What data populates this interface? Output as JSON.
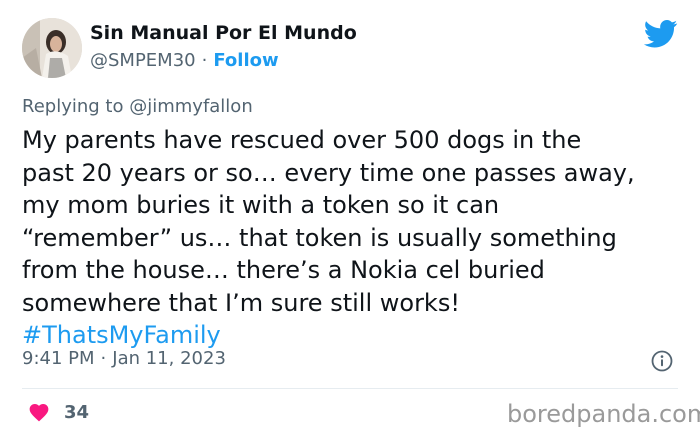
{
  "author": {
    "name": "Sin Manual Por El Mundo",
    "handle": "@SMPEM30",
    "separator": "·",
    "follow_label": "Follow"
  },
  "reply": {
    "prefix": "Replying to",
    "handle": "@jimmyfallon"
  },
  "body": {
    "lines": [
      "My parents have rescued over 500 dogs in the",
      "past 20 years or so… every time one passes away,",
      "my mom buries it with a token so it can",
      "“remember” us… that token is usually something",
      "from the house… there’s a Nokia cel buried",
      "somewhere that I’m sure still works!"
    ],
    "hashtag": "#ThatsMyFamily"
  },
  "meta": {
    "time": "9:41 PM",
    "separator": "·",
    "date": "Jan 11, 2023"
  },
  "engagement": {
    "likes": "34"
  },
  "watermark": "boredpanda.com",
  "icons": {
    "brand": "twitter-bird-icon",
    "info": "info-icon",
    "like": "heart-icon"
  },
  "colors": {
    "accent": "#1d9bf0",
    "text": "#0f1419",
    "muted": "#536471",
    "heart": "#f91880",
    "watermark": "#9a9a9a"
  }
}
